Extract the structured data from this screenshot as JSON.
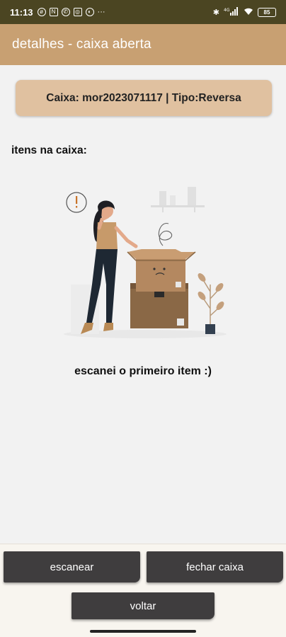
{
  "status_bar": {
    "time": "11:13",
    "left_icons": [
      "muted-notification-icon",
      "nfc-icon",
      "whatsapp-icon",
      "instagram-icon",
      "chrome-icon",
      "more-dots-icon"
    ],
    "more": "···",
    "network": "4G",
    "battery": "85"
  },
  "app_bar": {
    "title": "detalhes - caixa aberta"
  },
  "info_card": {
    "text": "Caixa: mor2023071117 | Tipo:Reversa"
  },
  "section": {
    "label": "itens na caixa:"
  },
  "empty_state": {
    "message": "escanei o primeiro item :)"
  },
  "buttons": {
    "scan": "escanear",
    "close": "fechar caixa",
    "back": "voltar"
  },
  "colors": {
    "status_bar": "#4b4522",
    "app_bar": "#c8a072",
    "card": "#e0c1a0",
    "button": "#3f3d3e",
    "background": "#f2f2f2"
  }
}
